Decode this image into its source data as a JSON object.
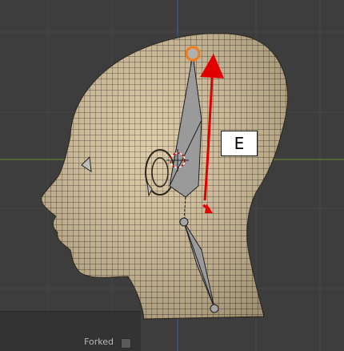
{
  "viewport": {
    "background": "#3d3d3d",
    "grid_color": "#4a4a4a",
    "axis_x_color": "#6c8a2a",
    "axis_z_color": "#3f62a8",
    "mesh_fill": "#d8c29a",
    "bone_color": "#9a9a9a",
    "selection_color": "#f07c1a",
    "arrow_color": "#e00000"
  },
  "annotation": {
    "key_label": "E"
  },
  "operator_panel": {
    "forked_label": "Forked",
    "forked_checked": false
  }
}
